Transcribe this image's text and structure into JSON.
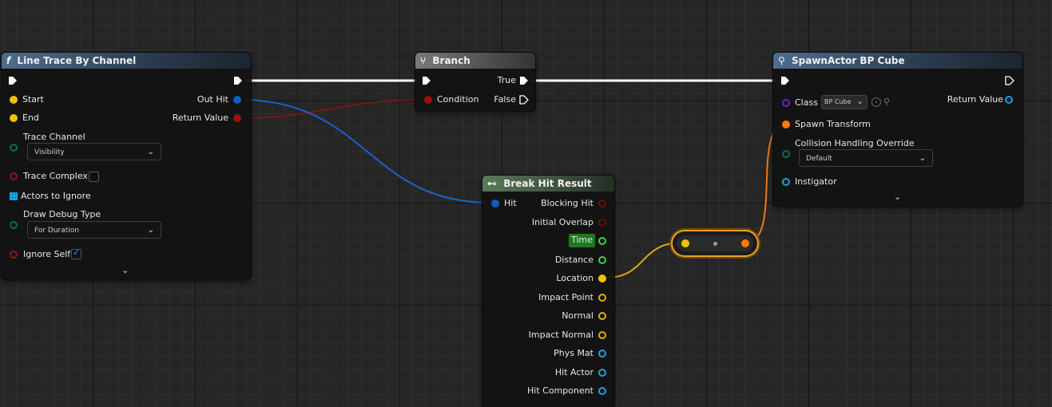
{
  "colors": {
    "exec": "#ffffff",
    "struct": "#0a5fc4",
    "bool": "#9b1010",
    "vector": "#f2c200",
    "float": "#3bd14a",
    "transform": "#ff7a00",
    "object": "#1ba1e2",
    "class": "#6a1fd0",
    "byte": "#0b6b5a"
  },
  "line_trace": {
    "title": "Line Trace By Channel",
    "icon": "function-icon",
    "start": "Start",
    "end": "End",
    "trace_channel": "Trace Channel",
    "trace_channel_value": "Visibility",
    "trace_complex": "Trace Complex",
    "actors_to_ignore": "Actors to Ignore",
    "draw_debug_type": "Draw Debug Type",
    "draw_debug_value": "For Duration",
    "ignore_self": "Ignore Self",
    "out_hit": "Out Hit",
    "return_value": "Return Value"
  },
  "branch": {
    "title": "Branch",
    "icon": "branch-icon",
    "condition": "Condition",
    "true_label": "True",
    "false_label": "False"
  },
  "spawn": {
    "title": "SpawnActor BP Cube",
    "icon": "spawn-icon",
    "class_label": "Class",
    "class_value": "BP Cube",
    "return_value": "Return Value",
    "spawn_transform": "Spawn Transform",
    "collision_label": "Collision Handling Override",
    "collision_value": "Default",
    "instigator": "Instigator"
  },
  "break_hit": {
    "title": "Break Hit Result",
    "icon": "break-struct-icon",
    "hit": "Hit",
    "outputs": [
      "Blocking Hit",
      "Initial Overlap",
      "Time",
      "Distance",
      "Location",
      "Impact Point",
      "Normal",
      "Impact Normal",
      "Phys Mat",
      "Hit Actor",
      "Hit Component"
    ]
  }
}
